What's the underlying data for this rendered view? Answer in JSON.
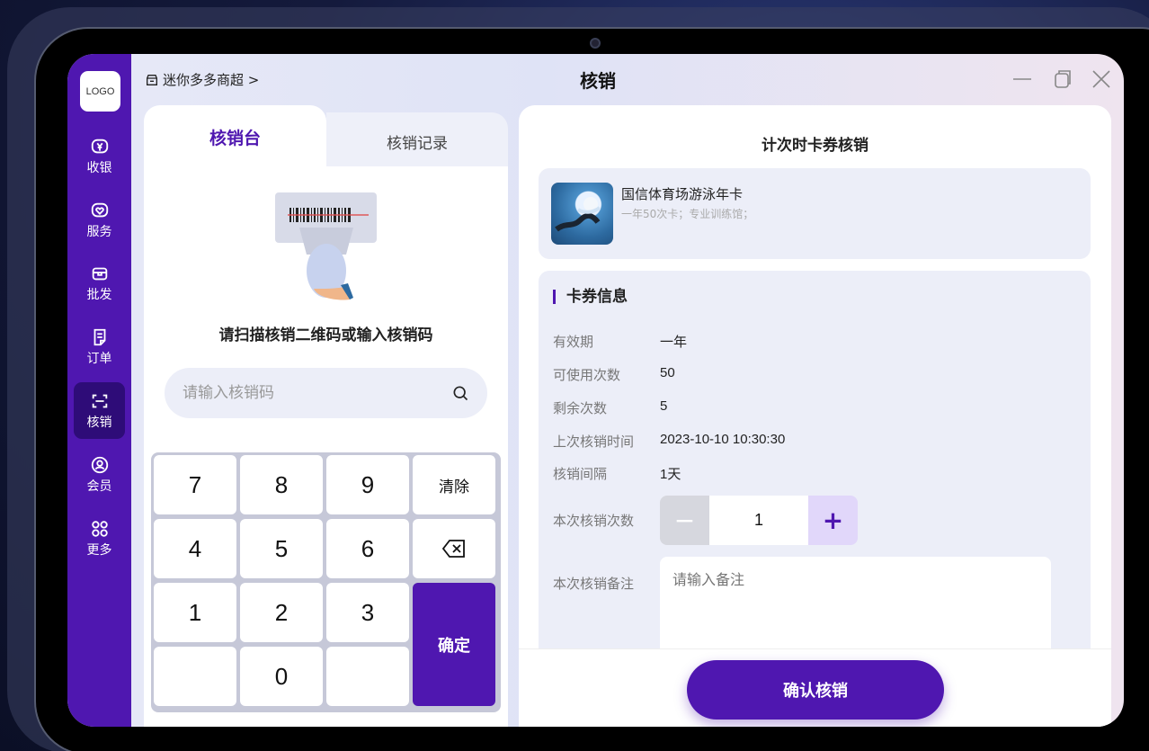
{
  "brand": {
    "logo_text": "LOGO",
    "accent": "#4f17b0"
  },
  "sidebar": {
    "items": [
      {
        "label": "收银",
        "icon": "yen-icon"
      },
      {
        "label": "服务",
        "icon": "heart-icon"
      },
      {
        "label": "批发",
        "icon": "box-icon"
      },
      {
        "label": "订单",
        "icon": "document-icon"
      },
      {
        "label": "核销",
        "icon": "scan-icon",
        "active": true
      },
      {
        "label": "会员",
        "icon": "member-icon"
      },
      {
        "label": "更多",
        "icon": "grid-icon"
      }
    ]
  },
  "header": {
    "store_name": "迷你多多商超 >",
    "title": "核销"
  },
  "left": {
    "tabs": [
      {
        "label": "核销台",
        "active": true
      },
      {
        "label": "核销记录"
      }
    ],
    "scan_prompt": "请扫描核销二维码或输入核销码",
    "search_placeholder": "请输入核销码",
    "keys": {
      "k7": "7",
      "k8": "8",
      "k9": "9",
      "clear": "清除",
      "k4": "4",
      "k5": "5",
      "k6": "6",
      "k1": "1",
      "k2": "2",
      "k3": "3",
      "k0": "0",
      "confirm": "确定"
    }
  },
  "right": {
    "title": "计次时卡券核销",
    "card": {
      "name": "国信体育场游泳年卡",
      "desc": "一年50次卡；专业训练馆；"
    },
    "info": {
      "heading": "卡券信息",
      "rows": [
        {
          "label": "有效期",
          "value": "一年"
        },
        {
          "label": "可使用次数",
          "value": "50"
        },
        {
          "label": "剩余次数",
          "value": "5"
        },
        {
          "label": "上次核销时间",
          "value": "2023-10-10 10:30:30"
        },
        {
          "label": "核销间隔",
          "value": "1天"
        }
      ],
      "count_label": "本次核销次数",
      "count_value": "1",
      "remark_label": "本次核销备注",
      "remark_placeholder": "请输入备注"
    },
    "confirm_label": "确认核销"
  }
}
